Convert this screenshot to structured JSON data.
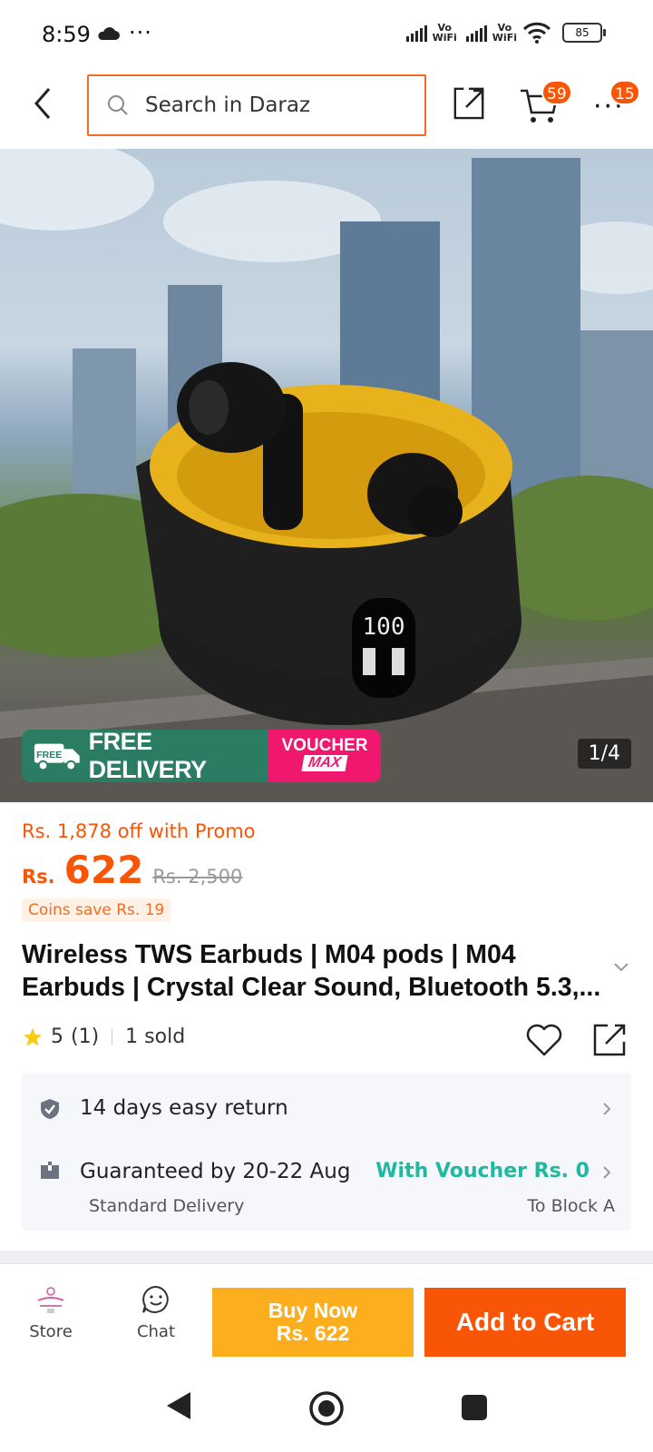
{
  "status_bar": {
    "time": "8:59",
    "dots": "···",
    "vowifi1": [
      "Vo",
      "WiFi"
    ],
    "vowifi2": [
      "Vo",
      "WiFi"
    ],
    "battery": "85"
  },
  "top_nav": {
    "search_placeholder": "Search in Daraz",
    "cart_badge": "59",
    "more_badge": "15"
  },
  "hero": {
    "counter": "1/4",
    "free_delivery": "FREE DELIVERY",
    "free_tag": "FREE",
    "voucher_line1": "VOUCHER",
    "voucher_line2": "MAX"
  },
  "product": {
    "promo": "Rs. 1,878 off with Promo",
    "currency": "Rs.",
    "price": "622",
    "old_price": "Rs. 2,500",
    "coins": "Coins save Rs. 19",
    "title": "Wireless TWS Earbuds | M04 pods | M04 Earbuds | Crystal Clear Sound, Bluetooth 5.3,...",
    "rating": "5",
    "rating_count": "(1)",
    "sold": "1 sold"
  },
  "delivery": {
    "return_text": "14 days easy return",
    "guarantee_text": "Guaranteed by 20-22 Aug",
    "voucher_text": "With Voucher Rs. 0",
    "delivery_type": "Standard Delivery",
    "destination": "To Block A"
  },
  "actions": {
    "store_label": "Store",
    "chat_label": "Chat",
    "buy_now_line1": "Buy Now",
    "buy_now_line2": "Rs. 622",
    "add_to_cart": "Add to Cart"
  },
  "colors": {
    "brand": "#f85606",
    "buy_now": "#fcae1e",
    "teal": "#1fb8a0",
    "free_delivery_green": "#2a7d63",
    "voucher_pink": "#f0176e"
  }
}
